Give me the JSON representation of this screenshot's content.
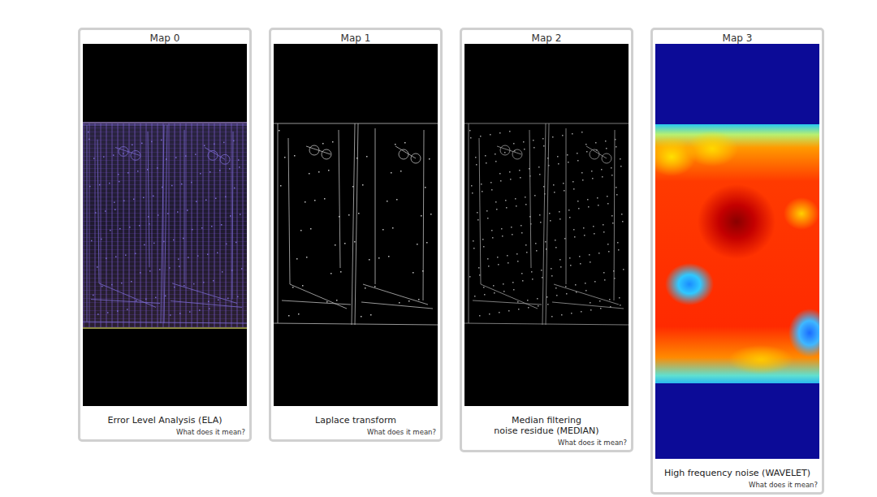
{
  "maps": [
    {
      "title": "Map 0",
      "kind": "ela",
      "caption": [
        "Error Level Analysis (ELA)"
      ],
      "help": "What does it mean?"
    },
    {
      "title": "Map 1",
      "kind": "laplace",
      "caption": [
        "Laplace transform"
      ],
      "help": "What does it mean?"
    },
    {
      "title": "Map 2",
      "kind": "median",
      "caption": [
        "Median filtering",
        "noise residue (MEDIAN)"
      ],
      "help": "What does it mean?"
    },
    {
      "title": "Map 3",
      "kind": "wavelet",
      "caption": [
        "High frequency noise (WAVELET)"
      ],
      "help": "What does it mean?"
    }
  ]
}
